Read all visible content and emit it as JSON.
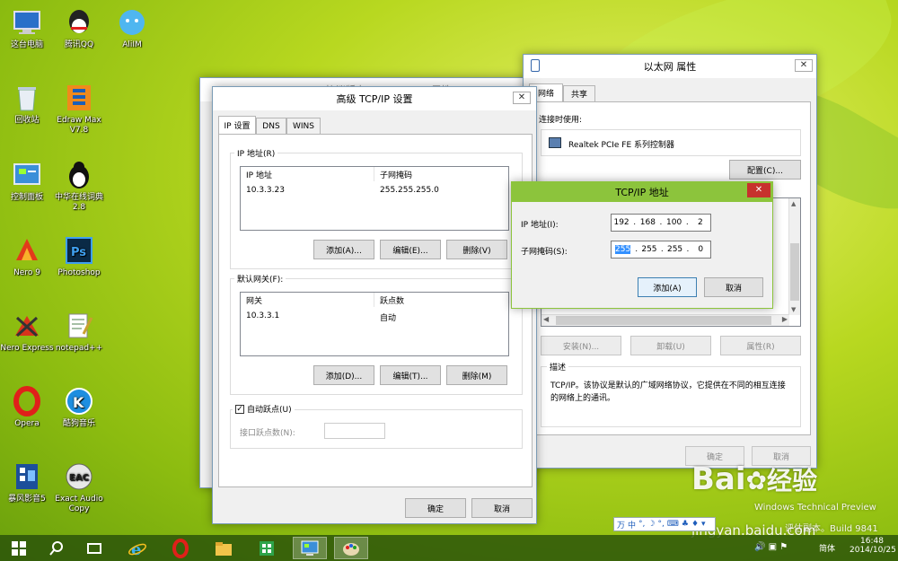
{
  "desktop": {
    "icons": [
      {
        "label": "这台电脑",
        "icon": "computer-icon"
      },
      {
        "label": "腾讯QQ",
        "icon": "qq-icon"
      },
      {
        "label": "AliIM",
        "icon": "aliim-icon"
      },
      {
        "label": "回收站",
        "icon": "recycle-bin-icon"
      },
      {
        "label": "Edraw Max V7.8",
        "icon": "edraw-icon"
      },
      {
        "label": "控制面板",
        "icon": "control-panel-icon"
      },
      {
        "label": "中华在线词典2.8",
        "icon": "dictionary-icon"
      },
      {
        "label": "Nero 9",
        "icon": "nero-icon"
      },
      {
        "label": "Photoshop",
        "icon": "photoshop-icon"
      },
      {
        "label": "Nero Express",
        "icon": "nero-express-icon"
      },
      {
        "label": "notepad++",
        "icon": "notepadpp-icon"
      },
      {
        "label": "Opera",
        "icon": "opera-icon"
      },
      {
        "label": "酷狗音乐",
        "icon": "kugou-icon"
      },
      {
        "label": "暴风影音5",
        "icon": "baofeng-icon"
      },
      {
        "label": "Exact Audio Copy",
        "icon": "eac-icon"
      }
    ]
  },
  "bg_window": {
    "title": "Internet 协议版本 4 (TCP/IPv4) 属性"
  },
  "advanced": {
    "title": "高级 TCP/IP 设置",
    "close": "✕",
    "tabs": [
      "IP 设置",
      "DNS",
      "WINS"
    ],
    "ip_group_label": "IP 地址(R)",
    "ip_headers": [
      "IP 地址",
      "子网掩码"
    ],
    "ip_rows": [
      {
        "ip": "10.3.3.23",
        "mask": "255.255.255.0"
      }
    ],
    "ip_buttons": {
      "add": "添加(A)...",
      "edit": "编辑(E)...",
      "delete": "删除(V)"
    },
    "gw_group_label": "默认网关(F):",
    "gw_headers": [
      "网关",
      "跃点数"
    ],
    "gw_rows": [
      {
        "gateway": "10.3.3.1",
        "metric": "自动"
      }
    ],
    "gw_buttons": {
      "add": "添加(D)...",
      "edit": "编辑(T)...",
      "delete": "删除(M)"
    },
    "auto_metric_label": "自动跃点(U)",
    "auto_metric_checked": true,
    "interface_metric_label": "接口跃点数(N):",
    "interface_metric_value": "",
    "ok": "确定",
    "cancel": "取消"
  },
  "ethernet": {
    "title": "以太网 属性",
    "close": "✕",
    "tabs": [
      "网络",
      "共享"
    ],
    "connect_using_label": "连接时使用:",
    "adapter": "Realtek PCIe FE 系列控制器",
    "configure": "配置(C)...",
    "install": "安装(N)...",
    "uninstall": "卸载(U)",
    "properties": "属性(R)",
    "description_label": "描述",
    "description": "TCP/IP。该协议是默认的广域网络协议，它提供在不同的相互连接的网络上的通讯。",
    "ok": "确定",
    "cancel": "取消"
  },
  "tcpip_dialog": {
    "title": "TCP/IP 地址",
    "close": "✕",
    "ip_label": "IP 地址(I):",
    "ip": [
      "192",
      "168",
      "100",
      "2"
    ],
    "mask_label": "子网掩码(S):",
    "mask": [
      "255",
      "255",
      "255",
      "0"
    ],
    "add": "添加(A)",
    "cancel": "取消"
  },
  "ime_bar": {
    "items": [
      "万",
      "中",
      "°,",
      "☽",
      "°,",
      "⌨",
      "♣",
      "♦",
      "▾"
    ]
  },
  "watermark": {
    "brand": "Bai",
    "brand_cn": "经验",
    "url": "jingyan.baidu.com",
    "preview_line1": "Windows Technical Preview",
    "preview_line2": "评估副本。Build 9841"
  },
  "taskbar": {
    "apps": [
      "windows-start-icon",
      "search-icon",
      "task-view-icon",
      "ie-icon",
      "opera-icon",
      "explorer-icon",
      "store-icon",
      "control-panel-icon",
      "paint-icon"
    ],
    "lang": "简体",
    "time": "16:48",
    "date": "2014/10/25"
  },
  "colors": {
    "dialog_title_green": "#8cc43c",
    "close_red": "#c7312d",
    "selection_blue": "#3390ff"
  }
}
